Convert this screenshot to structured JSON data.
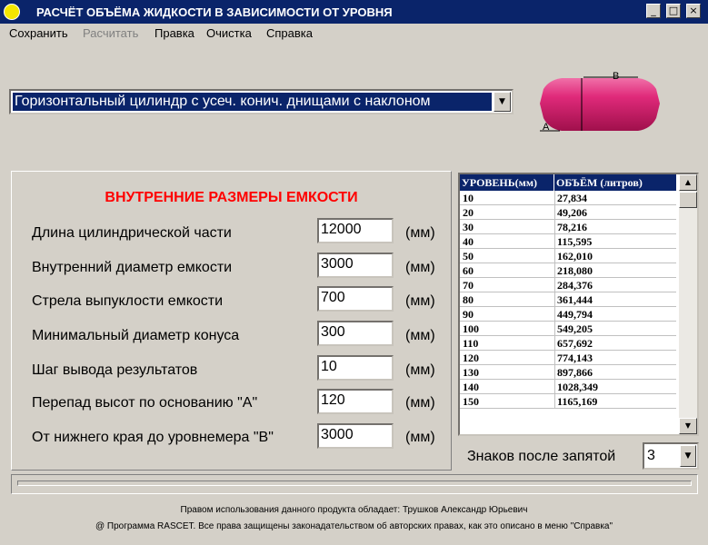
{
  "window": {
    "title": "РАСЧЁТ ОБЪЁМА ЖИДКОСТИ В ЗАВИСИМОСТИ ОТ УРОВНЯ",
    "minimize_glyph": "_",
    "maximize_glyph": "□",
    "close_glyph": "×"
  },
  "menu": {
    "items": [
      "Сохранить",
      "Расчитать",
      "Правка",
      "Очистка",
      "Справка"
    ],
    "disabled": [
      "Расчитать"
    ]
  },
  "tank_type": {
    "selected": "Горизонтальный цилиндр с усеч. конич. днищами с наклоном"
  },
  "tank_diagram": {
    "label_a": "A",
    "label_b": "B",
    "body_color": "#d81c6c"
  },
  "dimensions": {
    "title": "ВНУТРЕННИЕ РАЗМЕРЫ ЕМКОСТИ",
    "unit": "(мм)",
    "fields": [
      {
        "label": "Длина цилиндрической части",
        "value": "12000"
      },
      {
        "label": "Внутренний диаметр емкости",
        "value": "3000"
      },
      {
        "label": "Стрела выпуклости емкости",
        "value": "700"
      },
      {
        "label": "Минимальный диаметр конуса",
        "value": "300"
      },
      {
        "label": "Шаг вывода результатов",
        "value": "10"
      },
      {
        "label": "Перепад высот по основанию  \"А\"",
        "value": "120"
      },
      {
        "label": "От нижнего края до уровнемера \"В\"",
        "value": "3000"
      }
    ]
  },
  "results": {
    "col_level": "УРОВЕНЬ(мм)",
    "col_volume": "ОБЪЁМ (литров)",
    "rows": [
      {
        "level": "10",
        "volume": "27,834"
      },
      {
        "level": "20",
        "volume": "49,206"
      },
      {
        "level": "30",
        "volume": "78,216"
      },
      {
        "level": "40",
        "volume": "115,595"
      },
      {
        "level": "50",
        "volume": "162,010"
      },
      {
        "level": "60",
        "volume": "218,080"
      },
      {
        "level": "70",
        "volume": "284,376"
      },
      {
        "level": "80",
        "volume": "361,444"
      },
      {
        "level": "90",
        "volume": "449,794"
      },
      {
        "level": "100",
        "volume": "549,205"
      },
      {
        "level": "110",
        "volume": "657,692"
      },
      {
        "level": "120",
        "volume": "774,143"
      },
      {
        "level": "130",
        "volume": "897,866"
      },
      {
        "level": "140",
        "volume": "1028,349"
      },
      {
        "level": "150",
        "volume": "1165,169"
      }
    ]
  },
  "decimals": {
    "label": "Знаков после запятой",
    "value": "3"
  },
  "footer": {
    "rights_holder": "Правом использования данного продукта обладает: Трушков Александр Юрьевич",
    "copyright": "@  Программа  RASCET.  Все права защищены законадательством об авторских правах, как это описано в меню  \"Справка\""
  }
}
